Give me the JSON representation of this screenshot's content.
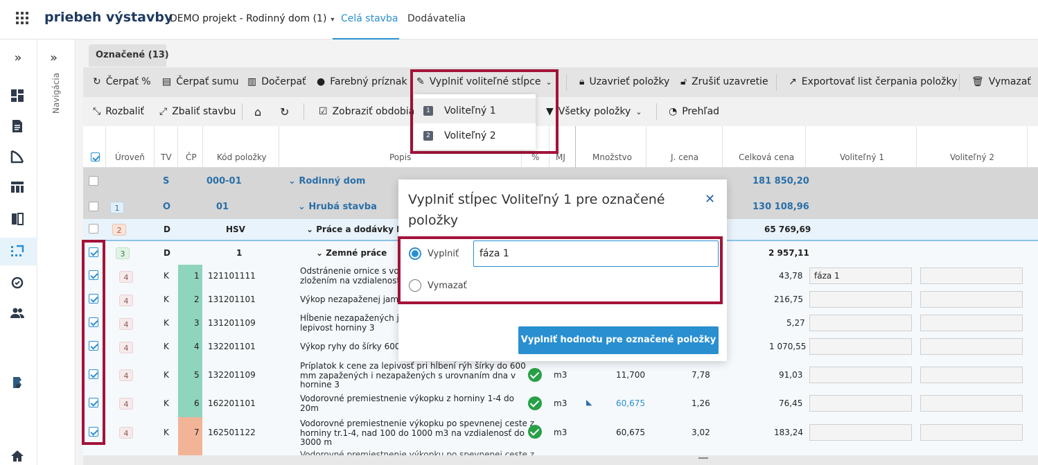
{
  "header": {
    "brand": "priebeh výstavby",
    "project": "DEMO projekt - Rodinný dom (1)",
    "tabs": [
      {
        "label": "Celá stavba",
        "active": true
      },
      {
        "label": "Dodávatelia",
        "active": false
      }
    ]
  },
  "nav": {
    "label": "Navigácia",
    "expand": "»"
  },
  "rail": {
    "icons": [
      "expand-icon",
      "dashboard-icon",
      "document-icon",
      "chart-icon",
      "table-icon",
      "compare-icon",
      "select-icon",
      "sync-icon",
      "users-icon",
      "brand-icon",
      "home-icon"
    ]
  },
  "tab_marked": "Označené (13)",
  "toolbar1": {
    "cerpat_pct": "Čerpať %",
    "cerpat_sumu": "Čerpať sumu",
    "docerpat": "Dočerpať",
    "farebny": "Farebný príznak",
    "vyplnit_volitelne": "Vyplniť voliteľné stĺpce",
    "uzavriet": "Uzavrieť položky",
    "zrusit": "Zrušiť uzavretie",
    "export": "Exportovať list čerpania položky",
    "vymazat": "Vymazať"
  },
  "toolbar2": {
    "rozbalit": "Rozbaliť",
    "zbalit": "Zbaliť stavbu",
    "zobrazit": "Zobraziť obdobia",
    "vsetky": "Všetky položky",
    "prehlad": "Prehľad"
  },
  "dropdown": {
    "items": [
      {
        "num": "1",
        "label": "Voliteľný 1"
      },
      {
        "num": "2",
        "label": "Voliteľný 2"
      }
    ]
  },
  "columns": {
    "uroven": "Úroveň",
    "tv": "TV",
    "cp": "ČP",
    "kod": "Kód položky",
    "popis": "Popis",
    "pct": "%",
    "mj": "MJ",
    "mnozstvo": "Množstvo",
    "jcena": "J. cena",
    "celkova": "Celková cena",
    "vol1": "Voliteľný 1",
    "vol2": "Voliteľný 2"
  },
  "rows": [
    {
      "level": "",
      "tv": "S",
      "cp": "",
      "kod": "000-01",
      "popis": "Rodinný dom",
      "celkova": "181 850,20"
    },
    {
      "level": "1",
      "tv": "O",
      "cp": "",
      "kod": "01",
      "popis": "Hrubá stavba",
      "celkova": "130 108,96"
    },
    {
      "level": "2",
      "tv": "D",
      "cp": "",
      "kod": "HSV",
      "popis": "Práce a dodávky HSV",
      "celkova": "65 769,69"
    },
    {
      "level": "3",
      "tv": "D",
      "cp": "",
      "kod": "1",
      "popis": "Zemné práce",
      "celkova": "2 957,11"
    },
    {
      "level": "4",
      "tv": "K",
      "cp": "1",
      "kod": "121101111",
      "popis1": "Odstránenie ornice s vodo",
      "popis2": "zložením na vzdialenosť do",
      "celkova": "43,78",
      "vol1": "fáza 1"
    },
    {
      "level": "4",
      "tv": "K",
      "cp": "2",
      "kod": "131201101",
      "popis1": "Výkop nezapaženej jamy v",
      "celkova": "216,75",
      "vol1": ""
    },
    {
      "level": "4",
      "tv": "K",
      "cp": "3",
      "kod": "131201109",
      "popis1": "Hĺbenie nezapažených jám",
      "popis2": "lepivost horniny 3",
      "celkova": "5,27",
      "vol1": ""
    },
    {
      "level": "4",
      "tv": "K",
      "cp": "4",
      "kod": "132201101",
      "popis1": "Výkop ryhy do šírky 600 m",
      "celkova": "1 070,55",
      "vol1": ""
    },
    {
      "level": "4",
      "tv": "K",
      "cp": "5",
      "kod": "132201109",
      "popis1": "Príplatok k cene za lepivosť pri hĺbení rýh šírky do 600",
      "popis2": "mm zapažených i nezapažených s urovnaním dna v",
      "popis3": "hornine 3",
      "mj": "m3",
      "mnozstvo": "11,700",
      "jcena": "7,78",
      "celkova": "91,03",
      "vol1": ""
    },
    {
      "level": "4",
      "tv": "K",
      "cp": "6",
      "kod": "162201101",
      "popis1": "Vodorovné premiestnenie výkopku z horniny 1-4 do",
      "popis2": "20m",
      "mj": "m3",
      "mnozstvo": "60,675",
      "jcena": "1,26",
      "celkova": "76,45",
      "vol1": ""
    },
    {
      "level": "4",
      "tv": "K",
      "cp": "7",
      "kod": "162501122",
      "popis1": "Vodorovné premiestnenie výkopku po spevnenej ceste z",
      "popis2": "horniny tr.1-4, nad 100 do 1000 m3 na vzdialenosť do",
      "popis3": "3000 m",
      "mj": "m3",
      "mnozstvo": "60,675",
      "jcena": "3,02",
      "celkova": "183,24",
      "vol1": ""
    }
  ],
  "row_partial": "Vodorovné premiestnenie výkopku po spevnenej ceste z",
  "modal": {
    "title": "Vyplniť stĺpec Voliteľný 1 pre označené položky",
    "opt_fill": "Vyplniť",
    "opt_clear": "Vymazať",
    "input_value": "fáza 1",
    "submit": "Vyplniť hodnotu pre označené položky"
  },
  "colors": {
    "accent": "#2a8fd0",
    "highlight": "#a3133a",
    "cp_green": "#8fd4bc",
    "cp_orange": "#f2b497",
    "ok": "#27a046"
  }
}
